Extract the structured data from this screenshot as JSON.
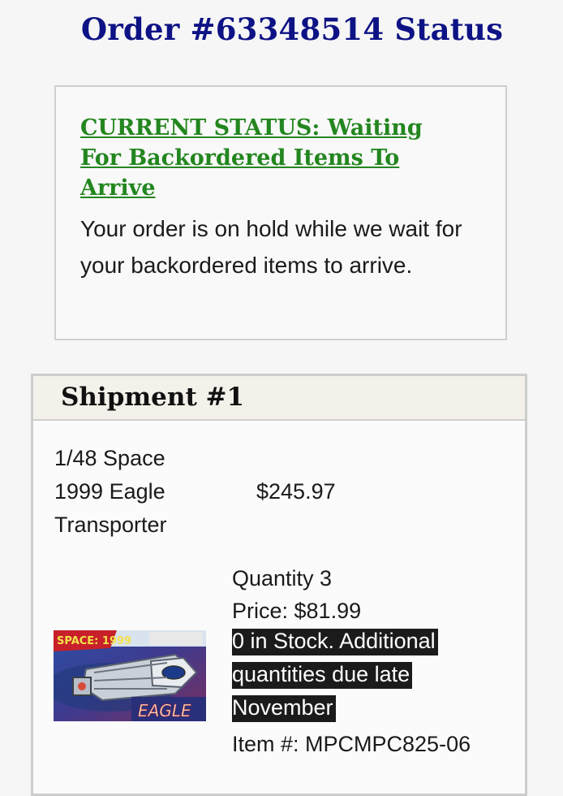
{
  "page": {
    "title": "Order #63348514 Status"
  },
  "status": {
    "link_text": "CURRENT STATUS: Waiting For Backordered Items To Arrive",
    "description": "Your order is on hold while we wait for your backordered items to arrive."
  },
  "shipment": {
    "title": "Shipment #1",
    "item": {
      "name": "1/48 Space 1999 Eagle Transporter",
      "total": "$245.97",
      "quantity": "Quantity 3",
      "price": "Price: $81.99",
      "stock_note": " 0 in Stock. Additional quantities due late November",
      "item_number": "Item #: MPCMPC825-06",
      "image_text_top": "SPACE: 1999",
      "image_text_bottom": "EAGLE"
    }
  },
  "colors": {
    "title_navy": "#0d1285",
    "status_green": "#23861f",
    "highlight_bg": "#1b1b1b"
  }
}
